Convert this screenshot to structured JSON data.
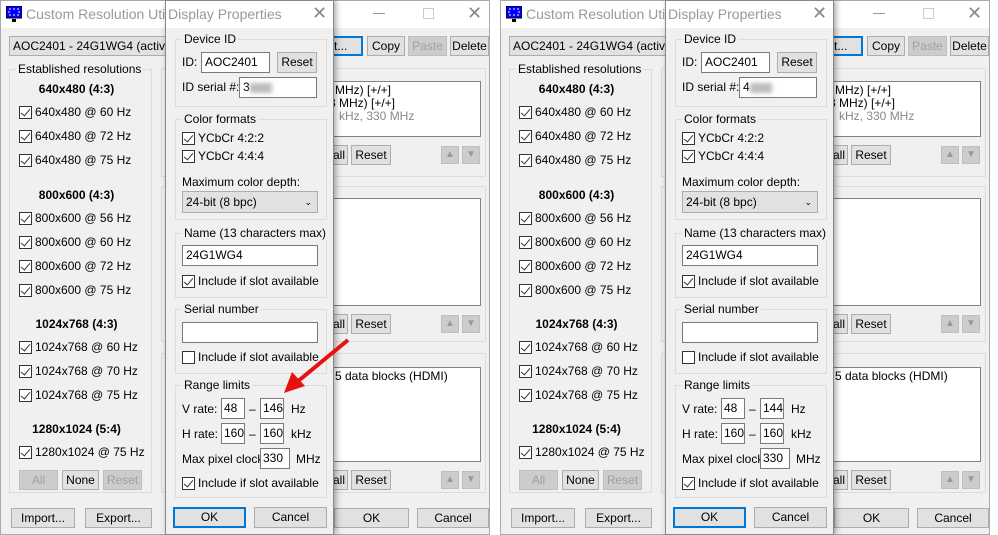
{
  "main": {
    "title": "Custom Resolution Utility",
    "device_select": "AOC2401 - 24G1WG4 (active)*",
    "edit_label": "Edit...",
    "copy_label": "Copy",
    "paste_label": "Paste",
    "delete_label": "Delete",
    "established_title": "Established resolutions",
    "groups": [
      {
        "header": "640x480 (4:3)",
        "items": [
          "640x480 @ 60 Hz",
          "640x480 @ 72 Hz",
          "640x480 @ 75 Hz"
        ]
      },
      {
        "header": "800x600 (4:3)",
        "items": [
          "800x600 @ 56 Hz",
          "800x600 @ 60 Hz",
          "800x600 @ 72 Hz",
          "800x600 @ 75 Hz"
        ]
      },
      {
        "header": "1024x768 (4:3)",
        "items": [
          "1024x768 @ 60 Hz",
          "1024x768 @ 70 Hz",
          "1024x768 @ 75 Hz"
        ]
      },
      {
        "header": "1280x1024 (5:4)",
        "items": [
          "1280x1024 @ 75 Hz"
        ]
      }
    ],
    "all_label": "All",
    "none_label": "None",
    "reset_label": "Reset",
    "import_label": "Import...",
    "export_label": "Export...",
    "detailed_lines": [
      "MHz) [+/+]",
      "3 MHz) [+/+]",
      "kHz, 330 MHz"
    ],
    "extension_line": "5 data blocks (HDMI)",
    "all_partial": "all",
    "ok_label": "OK",
    "cancel_label": "Cancel",
    "up_icon": "▲",
    "down_icon": "▼"
  },
  "dialog": {
    "title": "Display Properties",
    "device_id_title": "Device ID",
    "id_label": "ID:",
    "id_value": "AOC2401",
    "reset_label": "Reset",
    "serial_label": "ID serial #:",
    "color_formats_title": "Color formats",
    "ycbcr422": "YCbCr 4:2:2",
    "ycbcr444": "YCbCr 4:4:4",
    "max_depth_label": "Maximum color depth:",
    "max_depth_value": "24-bit (8 bpc)",
    "name_title": "Name (13 characters max)",
    "name_value": "24G1WG4",
    "include_label": "Include if slot available",
    "serial_number_title": "Serial number",
    "serial_number_value": "",
    "range_title": "Range limits",
    "vrate_label": "V rate:",
    "hrate_label": "H rate:",
    "dash": "–",
    "hz": "Hz",
    "khz": "kHz",
    "pixel_clock_label": "Max pixel clock:",
    "mhz": "MHz",
    "hrate_min": "160",
    "hrate_max": "160",
    "pixel_clock": "330",
    "vrate_min": "48",
    "ok_label": "OK",
    "cancel_label": "Cancel"
  },
  "panels": [
    {
      "id_serial_visible": "3",
      "vrate_max": "146",
      "annotation": "red-arrow"
    },
    {
      "id_serial_visible": "4",
      "vrate_max": "144"
    }
  ],
  "colors": {
    "annotation": "#e81010",
    "focus": "#0078d7"
  }
}
